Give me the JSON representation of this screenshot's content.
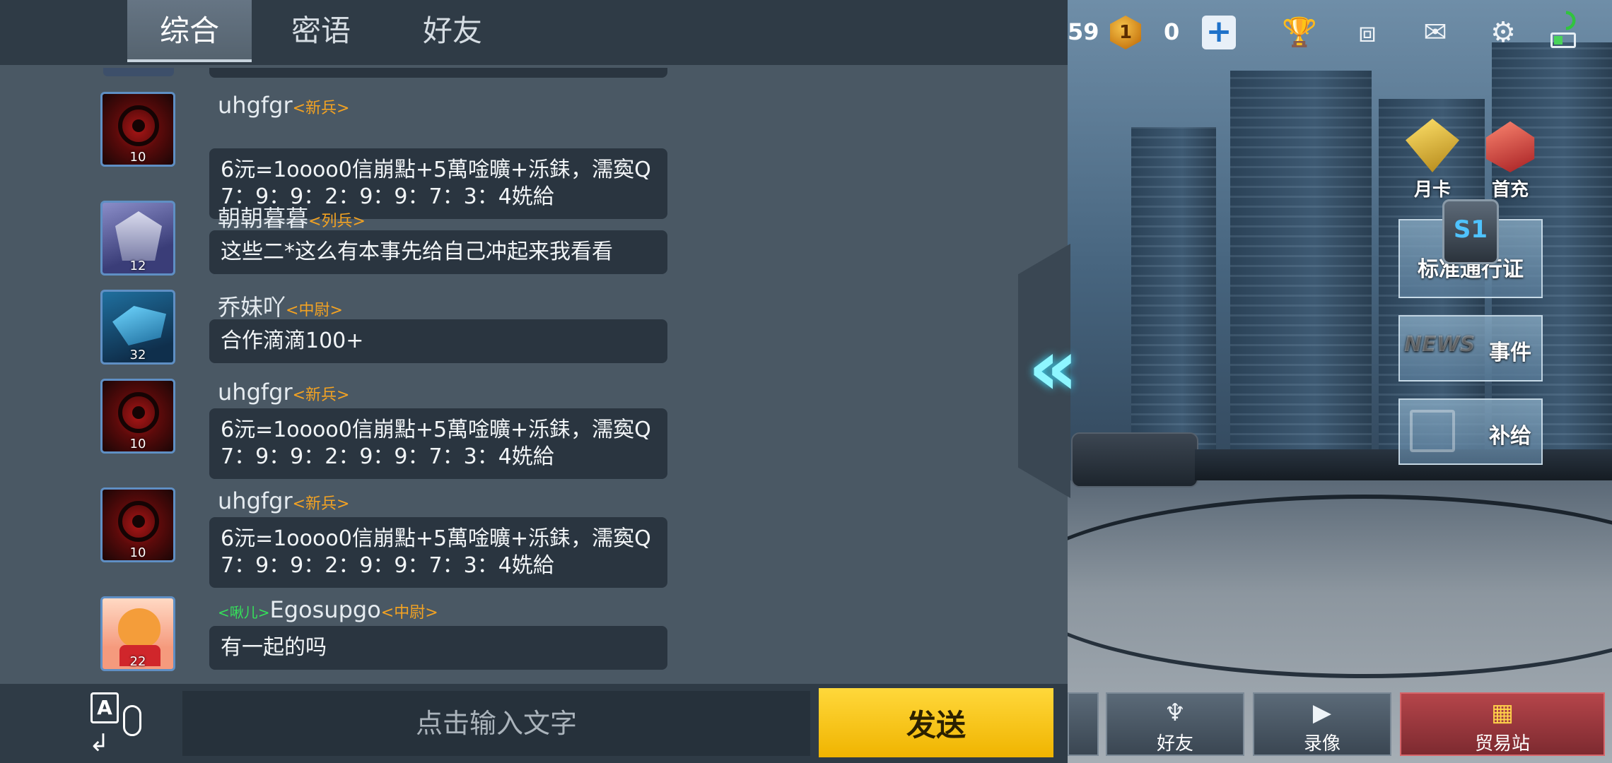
{
  "tabs": [
    {
      "label": "综合",
      "active": true
    },
    {
      "label": "密语",
      "active": false
    },
    {
      "label": "好友",
      "active": false
    }
  ],
  "messages": [
    {
      "name": "uhgfgr",
      "rank": "<新兵>",
      "level": "10",
      "avatar": "red-emblem",
      "lines": [
        "6沅=1oooo0信崩點+5萬唫曠+泺銇，濡寏Q",
        "7：9：9：2：9：9：7：3：4姺給"
      ]
    },
    {
      "name": "朝朝暮暮",
      "rank": "<列兵>",
      "level": "12",
      "avatar": "mech",
      "lines": [
        "这些二*这么有本事先给自己冲起来我看看"
      ]
    },
    {
      "name": "乔妹吖",
      "rank": "<中尉>",
      "level": "32",
      "avatar": "blue-mech",
      "lines": [
        "合作滴滴100+"
      ]
    },
    {
      "name": "uhgfgr",
      "rank": "<新兵>",
      "level": "10",
      "avatar": "red-emblem",
      "lines": [
        "6沅=1oooo0信崩點+5萬唫曠+泺銇，濡寏Q",
        "7：9：9：2：9：9：7：3：4姺給"
      ]
    },
    {
      "name": "uhgfgr",
      "rank": "<新兵>",
      "level": "10",
      "avatar": "red-emblem",
      "lines": [
        "6沅=1oooo0信崩點+5萬唫曠+泺銇，濡寏Q",
        "7：9：9：2：9：9：7：3：4姺給"
      ]
    },
    {
      "title": "<啾儿>",
      "name": "Egosupgo",
      "rank": "<中尉>",
      "level": "22",
      "avatar": "tiger",
      "lines": [
        "有一起的吗"
      ]
    }
  ],
  "input": {
    "placeholder": "点击输入文字",
    "value": ""
  },
  "send_label": "发送",
  "currency": {
    "partial_value": "59",
    "medal_count": "0",
    "medal_icon": "1"
  },
  "top_icons": [
    "trophy-icon",
    "cubes-icon",
    "mail-icon",
    "gear-icon"
  ],
  "side_badges": {
    "month_card": "月卡",
    "first_charge": "首充"
  },
  "panels": {
    "pass_label": "标准通行证",
    "pass_tag": "S1",
    "news_icon_text": "NEWS",
    "event_label": "事件",
    "supply_label": "补给"
  },
  "bottom_nav": {
    "friends": "好友",
    "replay": "录像",
    "trade": "贸易站"
  },
  "colors": {
    "accent_send": "#f0b400",
    "rank": "#f4a322",
    "title_tag": "#35e05a",
    "glow": "#8ef6ff"
  }
}
